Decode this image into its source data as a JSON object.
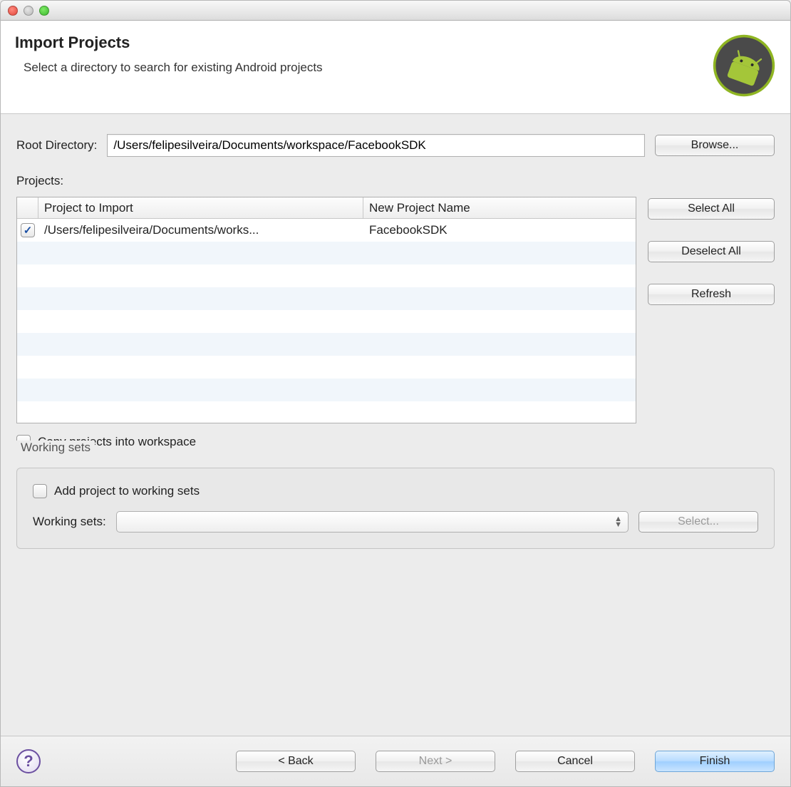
{
  "header": {
    "title": "Import Projects",
    "subtitle": "Select a directory to search for existing Android projects"
  },
  "root_directory": {
    "label": "Root Directory:",
    "value": "/Users/felipesilveira/Documents/workspace/FacebookSDK",
    "browse": "Browse..."
  },
  "projects_label": "Projects:",
  "table": {
    "headers": {
      "import": "Project to Import",
      "name": "New Project Name"
    },
    "rows": [
      {
        "checked": true,
        "import": "/Users/felipesilveira/Documents/works...",
        "name": "FacebookSDK"
      }
    ]
  },
  "side": {
    "select_all": "Select All",
    "deselect_all": "Deselect All",
    "refresh": "Refresh"
  },
  "copy_projects": {
    "checked": false,
    "label": "Copy projects into workspace"
  },
  "working_sets": {
    "title": "Working sets",
    "add": {
      "checked": false,
      "label": "Add project to working sets"
    },
    "row_label": "Working sets:",
    "select": "Select..."
  },
  "footer": {
    "back": "< Back",
    "next": "Next >",
    "cancel": "Cancel",
    "finish": "Finish"
  }
}
